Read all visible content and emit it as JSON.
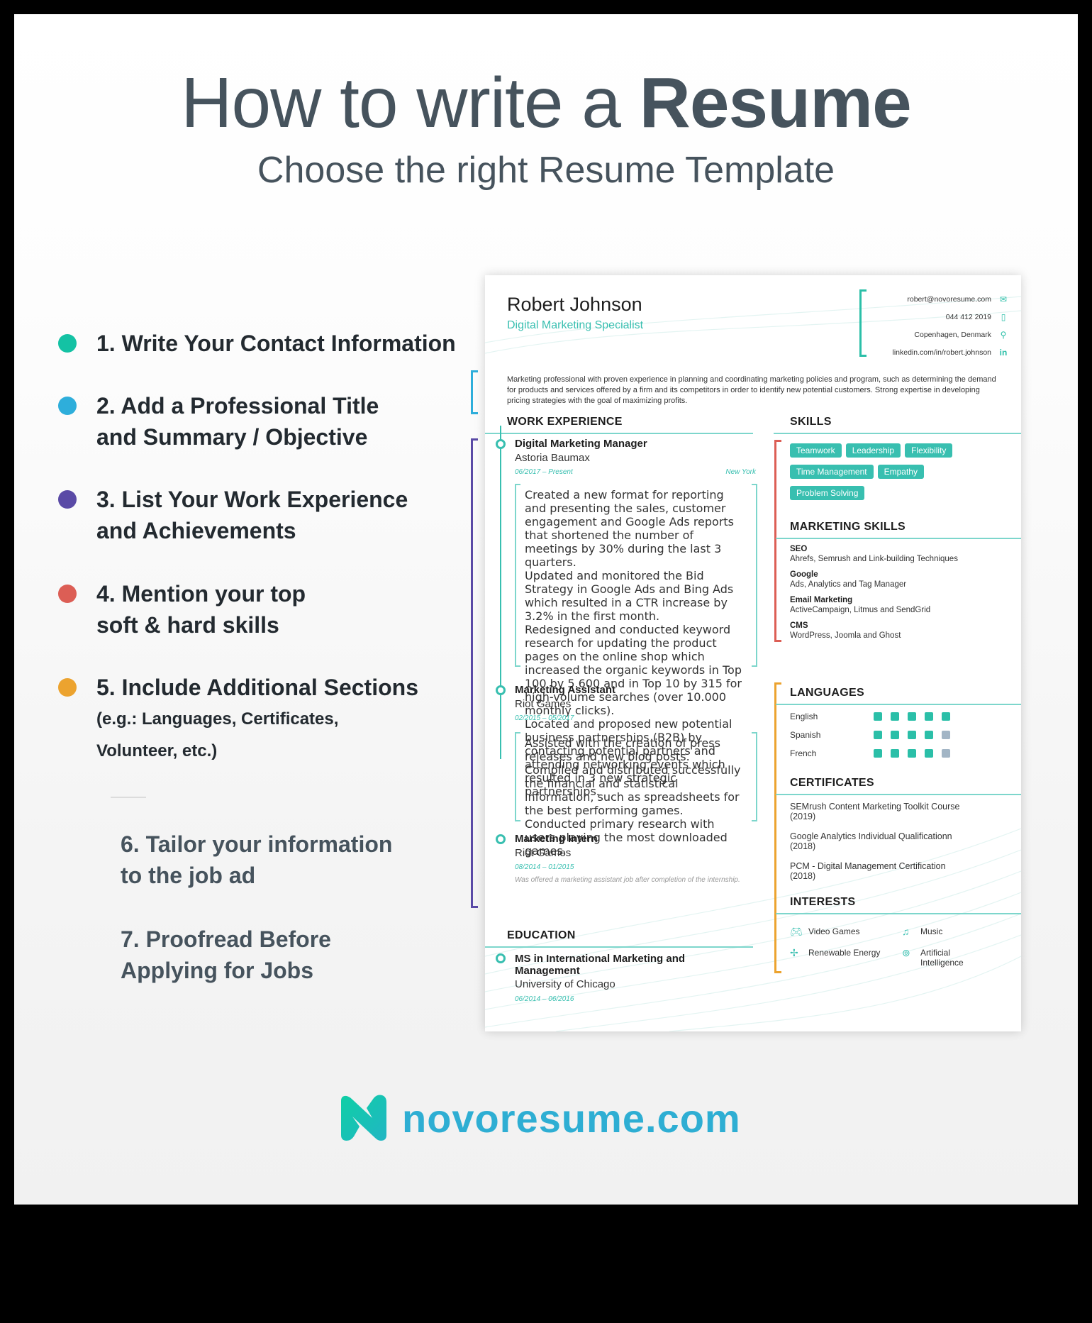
{
  "header": {
    "title_light": "How to write a ",
    "title_bold": "Resume",
    "subtitle": "Choose the right Resume Template"
  },
  "steps": [
    {
      "label": "1. Write Your Contact Information",
      "color": "#14c2a4"
    },
    {
      "label_line1": "2. Add a Professional Title",
      "label_line2": "and Summary / Objective",
      "color": "#2eaedb"
    },
    {
      "label_line1": "3. List Your Work Experience",
      "label_line2": "and Achievements",
      "color": "#5a4aa6"
    },
    {
      "label_line1": "4. Mention your top",
      "label_line2": "soft & hard skills",
      "color": "#dc5e55"
    },
    {
      "label": "5. Include Additional Sections",
      "sub_line1": "(e.g.: Languages, Certificates,",
      "sub_line2": "Volunteer, etc.)",
      "color": "#eca32f"
    },
    {
      "label_line1": "6. Tailor your information",
      "label_line2": "to the job ad"
    },
    {
      "label_line1": "7. Proofread Before",
      "label_line2": "Applying for Jobs"
    }
  ],
  "resume": {
    "name": "Robert Johnson",
    "title": "Digital Marketing Specialist",
    "contact": [
      {
        "value": "robert@novoresume.com",
        "icon": "email-icon"
      },
      {
        "value": "044 412 2019",
        "icon": "phone-icon"
      },
      {
        "value": "Copenhagen, Denmark",
        "icon": "location-pin-icon"
      },
      {
        "value": "linkedin.com/in/robert.johnson",
        "icon": "linkedin-icon"
      }
    ],
    "summary": "Marketing professional with proven experience in planning and coordinating marketing policies and program, such as determining the demand for products and services offered by a firm and its competitors in order to identify new potential customers. Strong expertise in developing pricing strategies with the goal of maximizing profits.",
    "work_experience": {
      "heading": "WORK EXPERIENCE",
      "jobs": [
        {
          "title": "Digital Marketing Manager",
          "company": "Astoria Baumax",
          "dates": "06/2017 – Present",
          "location": "New York",
          "bullets": [
            "Created a new format for reporting and presenting the sales, customer engagement and Google Ads reports that shortened the number of meetings by 30% during the last 3 quarters.",
            "Updated and monitored the Bid Strategy in Google Ads and Bing Ads which resulted in a CTR increase by 3.2% in the first month.",
            "Redesigned and conducted keyword research for updating the product pages on the online shop which increased the organic keywords in Top 100 by 5.600 and in Top 10 by 315 for high-volume searches (over 10.000 monthly clicks).",
            "Located and proposed new potential business partnerships (B2B) by contacting potential partners and attending networking events which resulted in 3 new strategic partnerships."
          ]
        },
        {
          "title": "Marketing Assistant",
          "company": "Riot Games",
          "dates": "02/2015 – 05/2017",
          "bullets": [
            "Assisted with the creation of press releases and new blog posts.",
            "Compiled and distributed successfully the financial and statistical information, such as spreadsheets for the best performing games.",
            "Conducted primary research with users playing the most downloaded games."
          ]
        },
        {
          "title": "Marketing Intern",
          "company": "Riot Games",
          "dates": "08/2014 – 01/2015",
          "note": "Was offered a marketing assistant job after completion of the internship."
        }
      ]
    },
    "education": {
      "heading": "EDUCATION",
      "degree": "MS in International Marketing and Management",
      "school": "University of Chicago",
      "dates": "06/2014 – 06/2016"
    },
    "skills": {
      "heading": "SKILLS",
      "items": [
        "Teamwork",
        "Leadership",
        "Flexibility",
        "Time Management",
        "Empathy",
        "Problem Solving"
      ]
    },
    "marketing_skills": {
      "heading": "MARKETING SKILLS",
      "items": [
        {
          "name": "SEO",
          "detail": "Ahrefs, Semrush and Link-building Techniques"
        },
        {
          "name": "Google",
          "detail": "Ads, Analytics and Tag Manager"
        },
        {
          "name": "Email Marketing",
          "detail": "ActiveCampaign, Litmus and SendGrid"
        },
        {
          "name": "CMS",
          "detail": "WordPress, Joomla and Ghost"
        }
      ]
    },
    "languages": {
      "heading": "LANGUAGES",
      "items": [
        {
          "name": "English",
          "level": 5,
          "max": 5
        },
        {
          "name": "Spanish",
          "level": 4,
          "max": 5
        },
        {
          "name": "French",
          "level": 4,
          "max": 5
        }
      ]
    },
    "certificates": {
      "heading": "CERTIFICATES",
      "items": [
        {
          "name": "SEMrush Content Marketing Toolkit Course",
          "year": "(2019)"
        },
        {
          "name": "Google Analytics Individual Qualificationn",
          "year": "(2018)"
        },
        {
          "name": "PCM - Digital Management Certification",
          "year": "(2018)"
        }
      ]
    },
    "interests": {
      "heading": "INTERESTS",
      "items": [
        {
          "label": "Video Games",
          "icon": "gamepad-icon"
        },
        {
          "label": "Music",
          "icon": "music-note-icon"
        },
        {
          "label": "Renewable Energy",
          "icon": "wind-turbine-icon"
        },
        {
          "label_line1": "Artificial",
          "label_line2": "Intelligence",
          "icon": "ai-chip-icon"
        }
      ]
    }
  },
  "brand": {
    "logo_text": "novoresume.com",
    "accent": "#38bfb0",
    "logo_color": "#2eaed3"
  }
}
